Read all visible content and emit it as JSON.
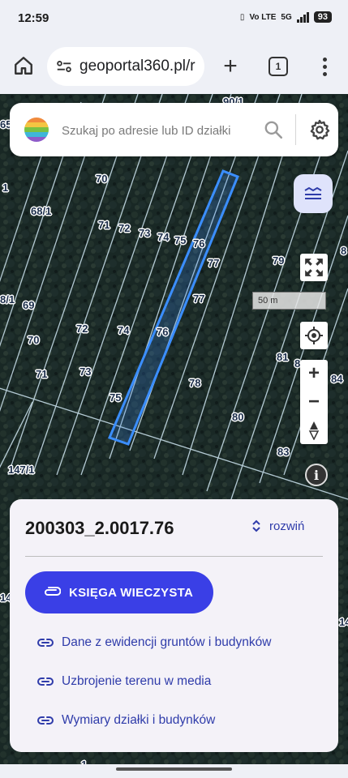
{
  "status": {
    "time": "12:59",
    "network": "5G",
    "volte": "Vo LTE",
    "battery": "93"
  },
  "browser": {
    "url": "geoportal360.pl/r",
    "tab_count": "1"
  },
  "search": {
    "placeholder": "Szukaj po adresie lub ID działki"
  },
  "map": {
    "scale_label": "50 m",
    "plot_labels": [
      "90/1",
      "65",
      "1",
      "70",
      "68/1",
      "71",
      "72",
      "73",
      "74",
      "75",
      "76",
      "77",
      "79",
      "8",
      "8/1",
      "69",
      "77",
      "72",
      "74",
      "76",
      "70",
      "81",
      "8",
      "71",
      "73",
      "78",
      "84",
      "75",
      "80",
      "83",
      "147/1",
      "14",
      "14",
      "1"
    ],
    "highlight_color": "#3b8eff"
  },
  "card": {
    "parcel_id": "200303_2.0017.76",
    "expand_label": "rozwiń",
    "primary_button": "KSIĘGA WIECZYSTA",
    "links": [
      "Dane z ewidencji gruntów i budynków",
      "Uzbrojenie terenu w media",
      "Wymiary działki i budynków"
    ]
  },
  "colors": {
    "accent": "#3a3fe6",
    "link": "#2f3caa"
  }
}
